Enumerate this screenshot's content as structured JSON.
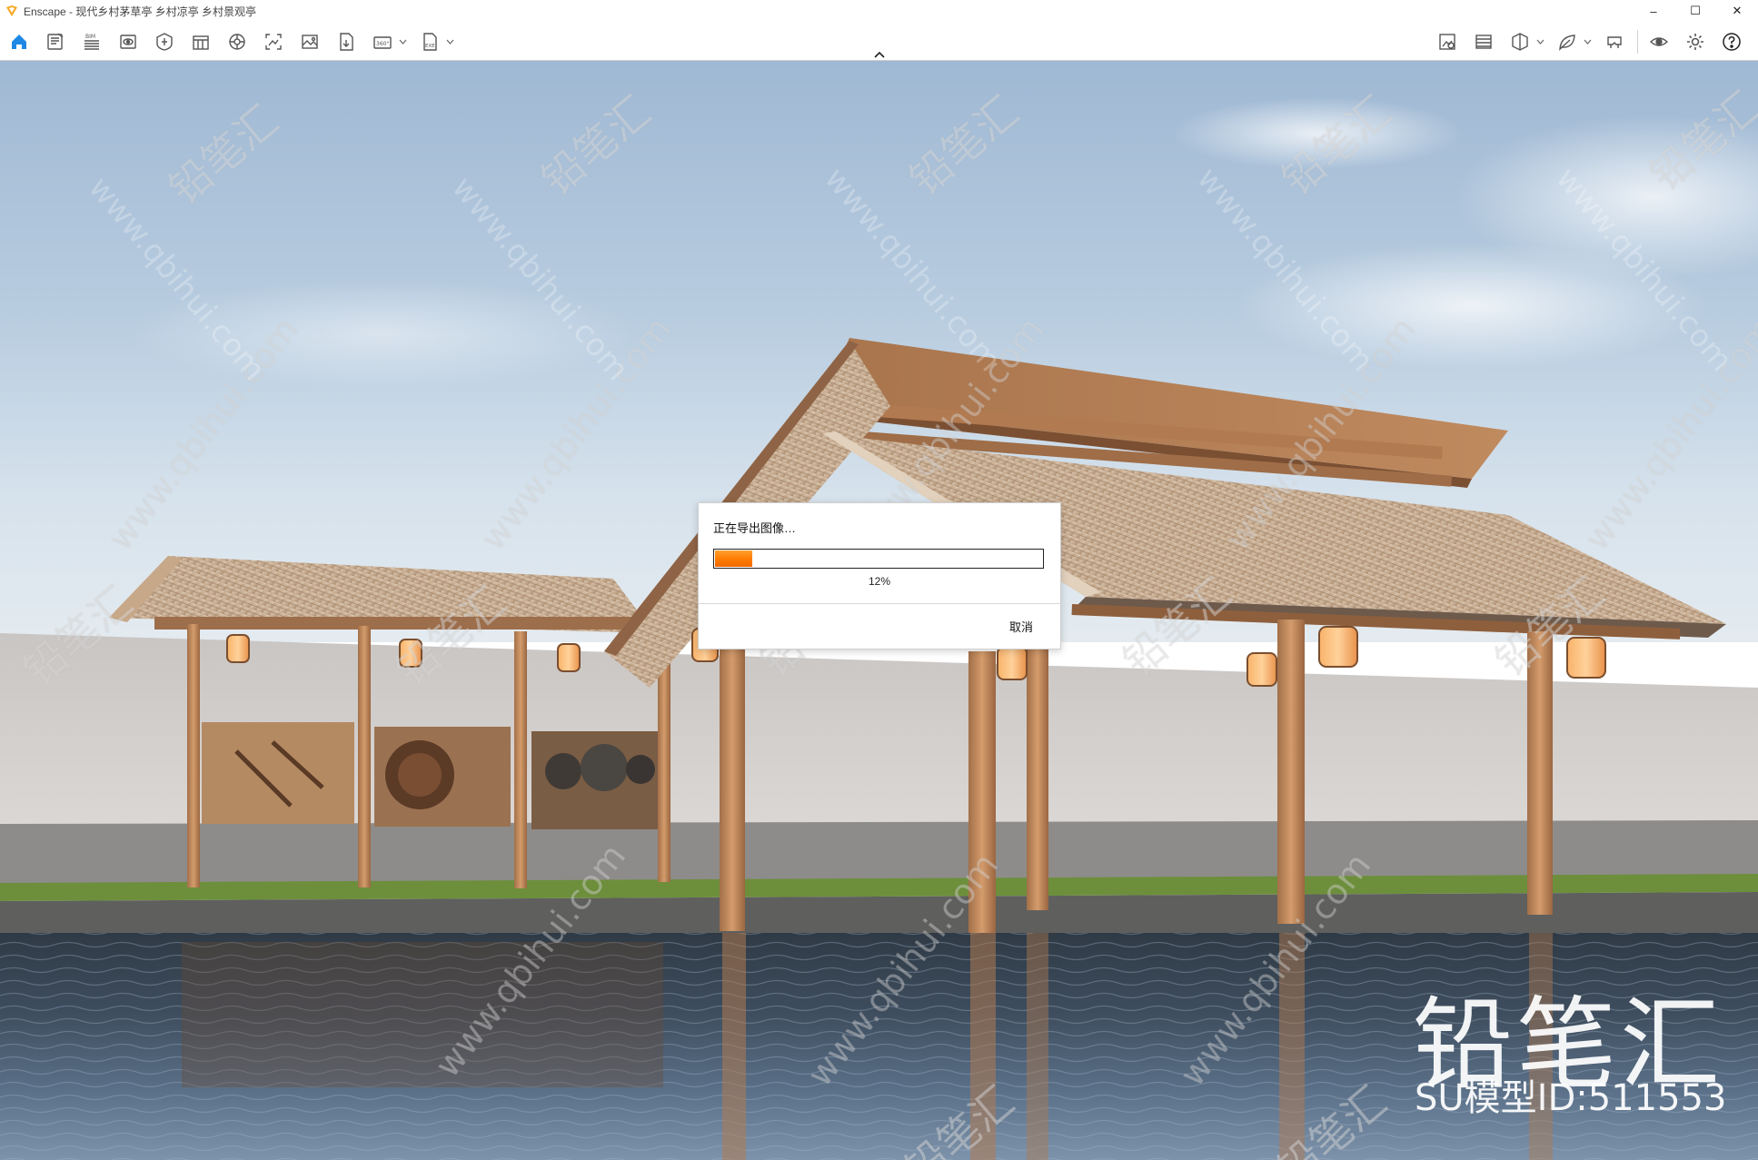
{
  "window": {
    "title": "Enscape - 现代乡村茅草亭 乡村凉亭 乡村景观亭",
    "controls": {
      "minimize": "–",
      "maximize": "☐",
      "close": "✕"
    }
  },
  "toolbar": {
    "left_icons": [
      "home-icon",
      "document-icon",
      "bim-icon",
      "view-icon",
      "asset-library-icon",
      "material-editor-icon",
      "visual-settings-icon",
      "screenshot-icon",
      "gallery-icon",
      "export-file-icon",
      "panorama-360-icon",
      "export-exe-icon"
    ],
    "bim_label": "BIM",
    "label_360": "360°",
    "exe_label": "EXE",
    "right_icons": [
      "capture-icon",
      "atmosphere-icon",
      "section-icon",
      "vr-icon",
      "camera-icon",
      "visibility-icon",
      "settings-icon",
      "help-icon"
    ]
  },
  "dialog": {
    "message": "正在导出图像…",
    "progress": 0.12,
    "percent_label": "12%",
    "cancel_label": "取消",
    "accent_color": "#ff7a00"
  },
  "watermark": {
    "brand": "铅笔汇",
    "model_id": "SU模型ID:511553",
    "url": "www.qbihui.com"
  }
}
